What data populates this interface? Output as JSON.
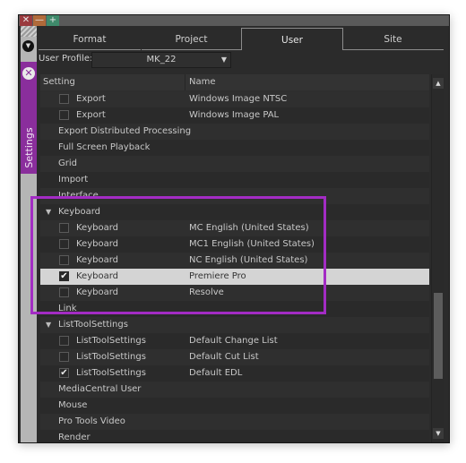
{
  "window": {
    "title_buttons": [
      {
        "name": "close",
        "glyph": "✕"
      },
      {
        "name": "minimize",
        "glyph": "—"
      },
      {
        "name": "maximize",
        "glyph": "+"
      }
    ]
  },
  "sidebar": {
    "collapse_glyph": "▼",
    "close_glyph": "✕",
    "tab_label": "Settings",
    "accent_color": "#8a2e9c"
  },
  "tabs": [
    {
      "label": "Format",
      "active": false
    },
    {
      "label": "Project",
      "active": false
    },
    {
      "label": "User",
      "active": true
    },
    {
      "label": "Site",
      "active": false
    }
  ],
  "profile": {
    "label": "User Profile:",
    "value": "MK_22",
    "arrow": "▼"
  },
  "table": {
    "columns": [
      "Setting",
      "Name"
    ],
    "rows": [
      {
        "setting": "Export",
        "name": "Windows Image NTSC",
        "checkbox": true,
        "checked": false,
        "level": 1
      },
      {
        "setting": "Export",
        "name": "Windows Image PAL",
        "checkbox": true,
        "checked": false,
        "level": 1
      },
      {
        "setting": "Export Distributed Processing",
        "name": "",
        "level": 0
      },
      {
        "setting": "Full Screen Playback",
        "name": "",
        "level": 0
      },
      {
        "setting": "Grid",
        "name": "",
        "level": 0
      },
      {
        "setting": "Import",
        "name": "",
        "level": 0
      },
      {
        "setting": "Interface",
        "name": "",
        "level": 0
      },
      {
        "setting": "Keyboard",
        "name": "",
        "level": 0,
        "expanded": true
      },
      {
        "setting": "Keyboard",
        "name": "MC English (United States)",
        "checkbox": true,
        "checked": false,
        "level": 1
      },
      {
        "setting": "Keyboard",
        "name": "MC1 English (United States)",
        "checkbox": true,
        "checked": false,
        "level": 1
      },
      {
        "setting": "Keyboard",
        "name": "NC English (United States)",
        "checkbox": true,
        "checked": false,
        "level": 1
      },
      {
        "setting": "Keyboard",
        "name": "Premiere Pro",
        "checkbox": true,
        "checked": true,
        "level": 1,
        "selected": true
      },
      {
        "setting": "Keyboard",
        "name": "Resolve",
        "checkbox": true,
        "checked": false,
        "level": 1
      },
      {
        "setting": "Link",
        "name": "",
        "level": 0
      },
      {
        "setting": "ListToolSettings",
        "name": "",
        "level": 0,
        "expanded": true
      },
      {
        "setting": "ListToolSettings",
        "name": "Default Change List",
        "checkbox": true,
        "checked": false,
        "level": 1
      },
      {
        "setting": "ListToolSettings",
        "name": "Default Cut List",
        "checkbox": true,
        "checked": false,
        "level": 1
      },
      {
        "setting": "ListToolSettings",
        "name": "Default EDL",
        "checkbox": true,
        "checked": true,
        "level": 1
      },
      {
        "setting": "MediaCentral User",
        "name": "",
        "level": 0
      },
      {
        "setting": "Mouse",
        "name": "",
        "level": 0
      },
      {
        "setting": "Pro Tools Video",
        "name": "",
        "level": 0
      },
      {
        "setting": "Render",
        "name": "",
        "level": 0
      }
    ]
  },
  "scrollbar": {
    "up_glyph": "▲",
    "down_glyph": "▼",
    "position_fraction": 0.62
  },
  "annotation": {
    "highlight_color": "#a32cc4",
    "highlights": "Keyboard group"
  }
}
